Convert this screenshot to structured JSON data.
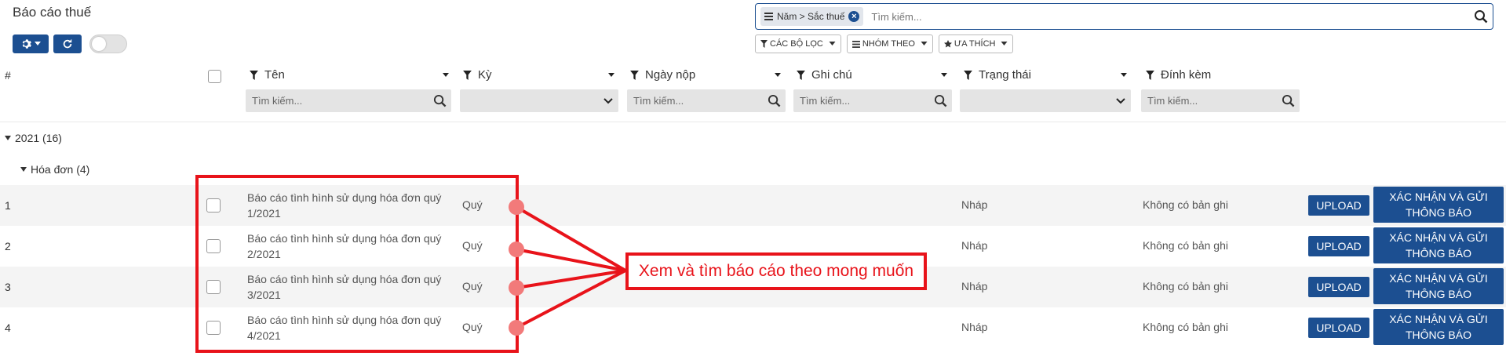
{
  "page": {
    "title": "Báo cáo thuế"
  },
  "search": {
    "facet_label": "Năm > Sắc thuế",
    "placeholder": "Tìm kiếm..."
  },
  "filters": {
    "filter_label": "CÁC BỘ LỌC",
    "group_label": "NHÓM THEO",
    "favorite_label": "ƯA THÍCH"
  },
  "table": {
    "hash": "#",
    "columns": [
      {
        "label": "Tên",
        "filter_placeholder": "Tìm kiếm..."
      },
      {
        "label": "Kỳ",
        "filter_placeholder": ""
      },
      {
        "label": "Ngày nộp",
        "filter_placeholder": "Tìm kiếm..."
      },
      {
        "label": "Ghi chú",
        "filter_placeholder": "Tìm kiếm..."
      },
      {
        "label": "Trạng thái",
        "filter_placeholder": ""
      },
      {
        "label": "Đính kèm",
        "filter_placeholder": "Tìm kiếm..."
      }
    ],
    "groups": [
      {
        "label": "2021 (16)"
      },
      {
        "label": "Hóa đơn (4)"
      }
    ],
    "rows": [
      {
        "num": "1",
        "name": "Báo cáo tình hình sử dụng hóa đơn quý 1/2021",
        "ky": "Quý",
        "status": "Nháp",
        "attachment": "Không có bản ghi",
        "upload": "UPLOAD",
        "confirm": "XÁC NHẬN VÀ GỬI THÔNG BÁO"
      },
      {
        "num": "2",
        "name": "Báo cáo tình hình sử dụng hóa đơn quý 2/2021",
        "ky": "Quý",
        "status": "Nháp",
        "attachment": "Không có bản ghi",
        "upload": "UPLOAD",
        "confirm": "XÁC NHẬN VÀ GỬI THÔNG BÁO"
      },
      {
        "num": "3",
        "name": "Báo cáo tình hình sử dụng hóa đơn quý 3/2021",
        "ky": "Quý",
        "status": "Nháp",
        "attachment": "Không có bản ghi",
        "upload": "UPLOAD",
        "confirm": "XÁC NHẬN VÀ GỬI THÔNG BÁO"
      },
      {
        "num": "4",
        "name": "Báo cáo tình hình sử dụng hóa đơn quý 4/2021",
        "ky": "Quý",
        "status": "Nháp",
        "attachment": "Không có bản ghi",
        "upload": "UPLOAD",
        "confirm": "XÁC NHẬN VÀ GỬI THÔNG BÁO"
      }
    ]
  },
  "annotation": {
    "text": "Xem và tìm báo cáo theo mong muốn"
  },
  "colors": {
    "primary": "#1c4f91",
    "annotation": "#e8131a"
  }
}
